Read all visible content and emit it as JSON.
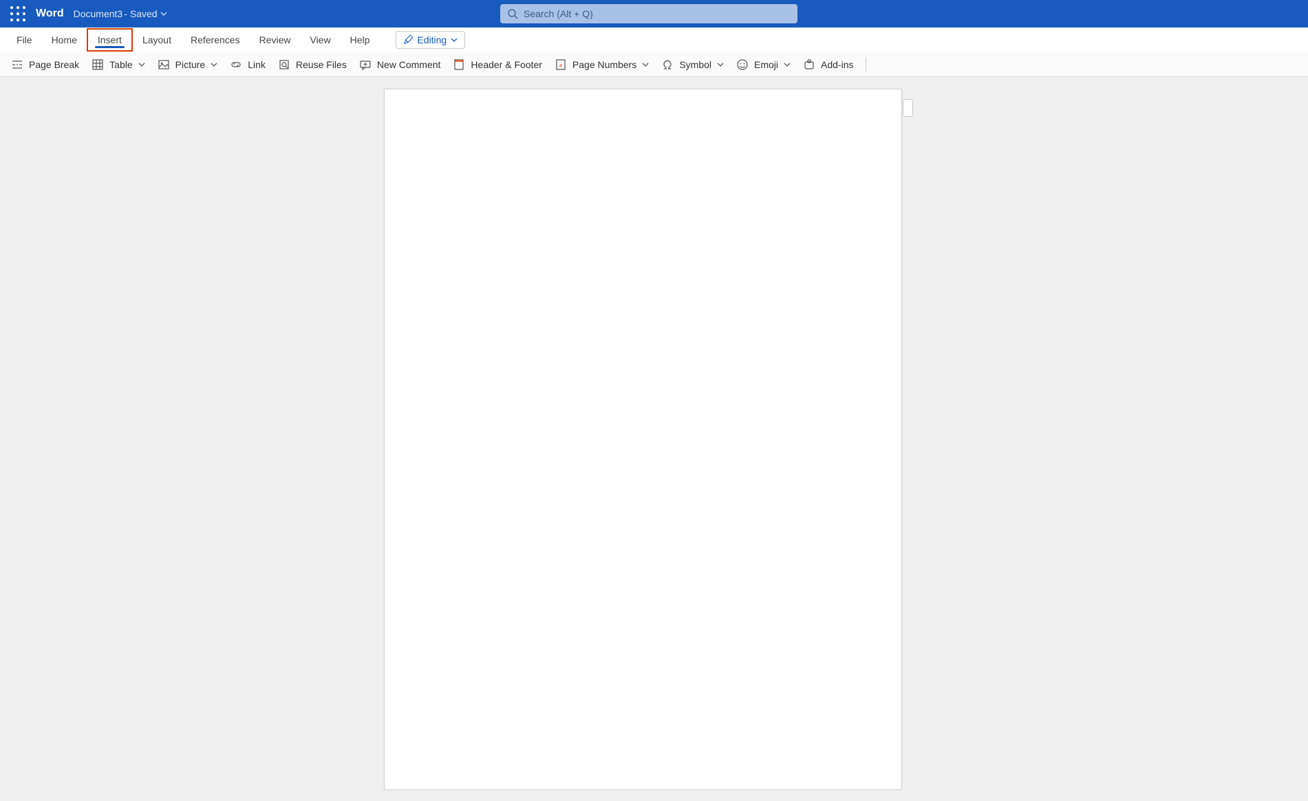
{
  "titleBar": {
    "appName": "Word",
    "docName": "Document3",
    "saveStatus": "Saved",
    "separator": " - "
  },
  "search": {
    "placeholder": "Search (Alt + Q)"
  },
  "tabs": {
    "file": "File",
    "home": "Home",
    "insert": "Insert",
    "layout": "Layout",
    "references": "References",
    "review": "Review",
    "view": "View",
    "help": "Help",
    "active": "insert"
  },
  "editingMode": {
    "label": "Editing"
  },
  "toolbar": {
    "pageBreak": "Page Break",
    "table": "Table",
    "picture": "Picture",
    "link": "Link",
    "reuseFiles": "Reuse Files",
    "newComment": "New Comment",
    "headerFooter": "Header & Footer",
    "pageNumbers": "Page Numbers",
    "symbol": "Symbol",
    "emoji": "Emoji",
    "addins": "Add-ins"
  }
}
